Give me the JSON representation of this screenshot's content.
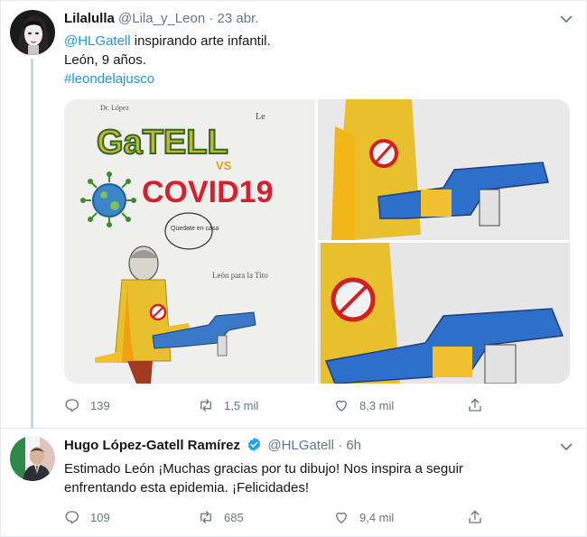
{
  "tweets": [
    {
      "author": {
        "name": "Lilalulla",
        "handle": "@Lila_y_Leon"
      },
      "time": "23 abr.",
      "text": {
        "mention": "@HLGatell",
        "line1_rest": " inspirando arte infantil.",
        "line2": "León, 9 años.",
        "hashtag": "#leondelajusco"
      },
      "media": {
        "drawing_texts": {
          "title": "GaTELL",
          "vs": "VS",
          "virus": "COVID19",
          "speech": "Quedate en casa",
          "signature": "León para la Tito",
          "corner_mark": "Le",
          "top_note": "Dr. López"
        }
      },
      "stats": {
        "replies": "139",
        "retweets": "1,5 mil",
        "likes": "8,3 mil"
      }
    },
    {
      "author": {
        "name": "Hugo López-Gatell Ramírez",
        "handle": "@HLGatell"
      },
      "time": "6h",
      "text": {
        "line1": "Estimado León ¡Muchas gracias por tu dibujo! Nos inspira a seguir",
        "line2": "enfrentando esta epidemia. ¡Felicidades!"
      },
      "stats": {
        "replies": "109",
        "retweets": "685",
        "likes": "9,4 mil"
      }
    }
  ],
  "separator": "·",
  "colors": {
    "link": "#1b95e0",
    "muted": "#657786",
    "verified": "#1da1f2",
    "text": "#14171a"
  },
  "icons": [
    "reply-icon",
    "retweet-icon",
    "like-icon",
    "share-icon",
    "verified-badge-icon",
    "chevron-down-icon"
  ]
}
